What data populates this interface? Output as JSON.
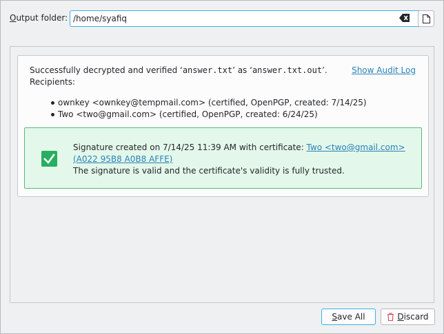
{
  "output": {
    "label_underlined": "O",
    "label_rest": "utput folder:",
    "path_value": "/home/syafiq"
  },
  "icons": {
    "clear": "clear-text-icon",
    "file": "document-open-icon",
    "check": "checkmark-icon",
    "trash": "trash-icon"
  },
  "result": {
    "msg_prefix": "Successfully decrypted and verified ‘",
    "in_file": "answer.txt",
    "msg_mid": "’ as ‘",
    "out_file": "answer.txt.out",
    "msg_suffix": "’.",
    "recipients_label": "Recipients:",
    "audit_link": "Show Audit Log",
    "recipients": [
      "ownkey <ownkey@tempmail.com> (certified, OpenPGP, created: 7/14/25)",
      "Two <two@gmail.com> (certified, OpenPGP, created: 6/24/25)"
    ]
  },
  "signature": {
    "prefix": "Signature created on 7/14/25 11:39 AM with certificate: ",
    "cert_link": "Two <two@gmail.com> (A022 95B8 A0B8 AFFE)",
    "validity": "The signature is valid and the certificate's validity is fully trusted."
  },
  "buttons": {
    "save_underlined": "S",
    "save_rest": "ave All",
    "discard_underlined": "D",
    "discard_rest": "iscard"
  },
  "colors": {
    "accent": "#3daee9",
    "link": "#2980b9",
    "success_bg": "#e3f8ea",
    "success_border": "#5ab679",
    "success_icon": "#27ae60",
    "danger": "#da4453"
  }
}
